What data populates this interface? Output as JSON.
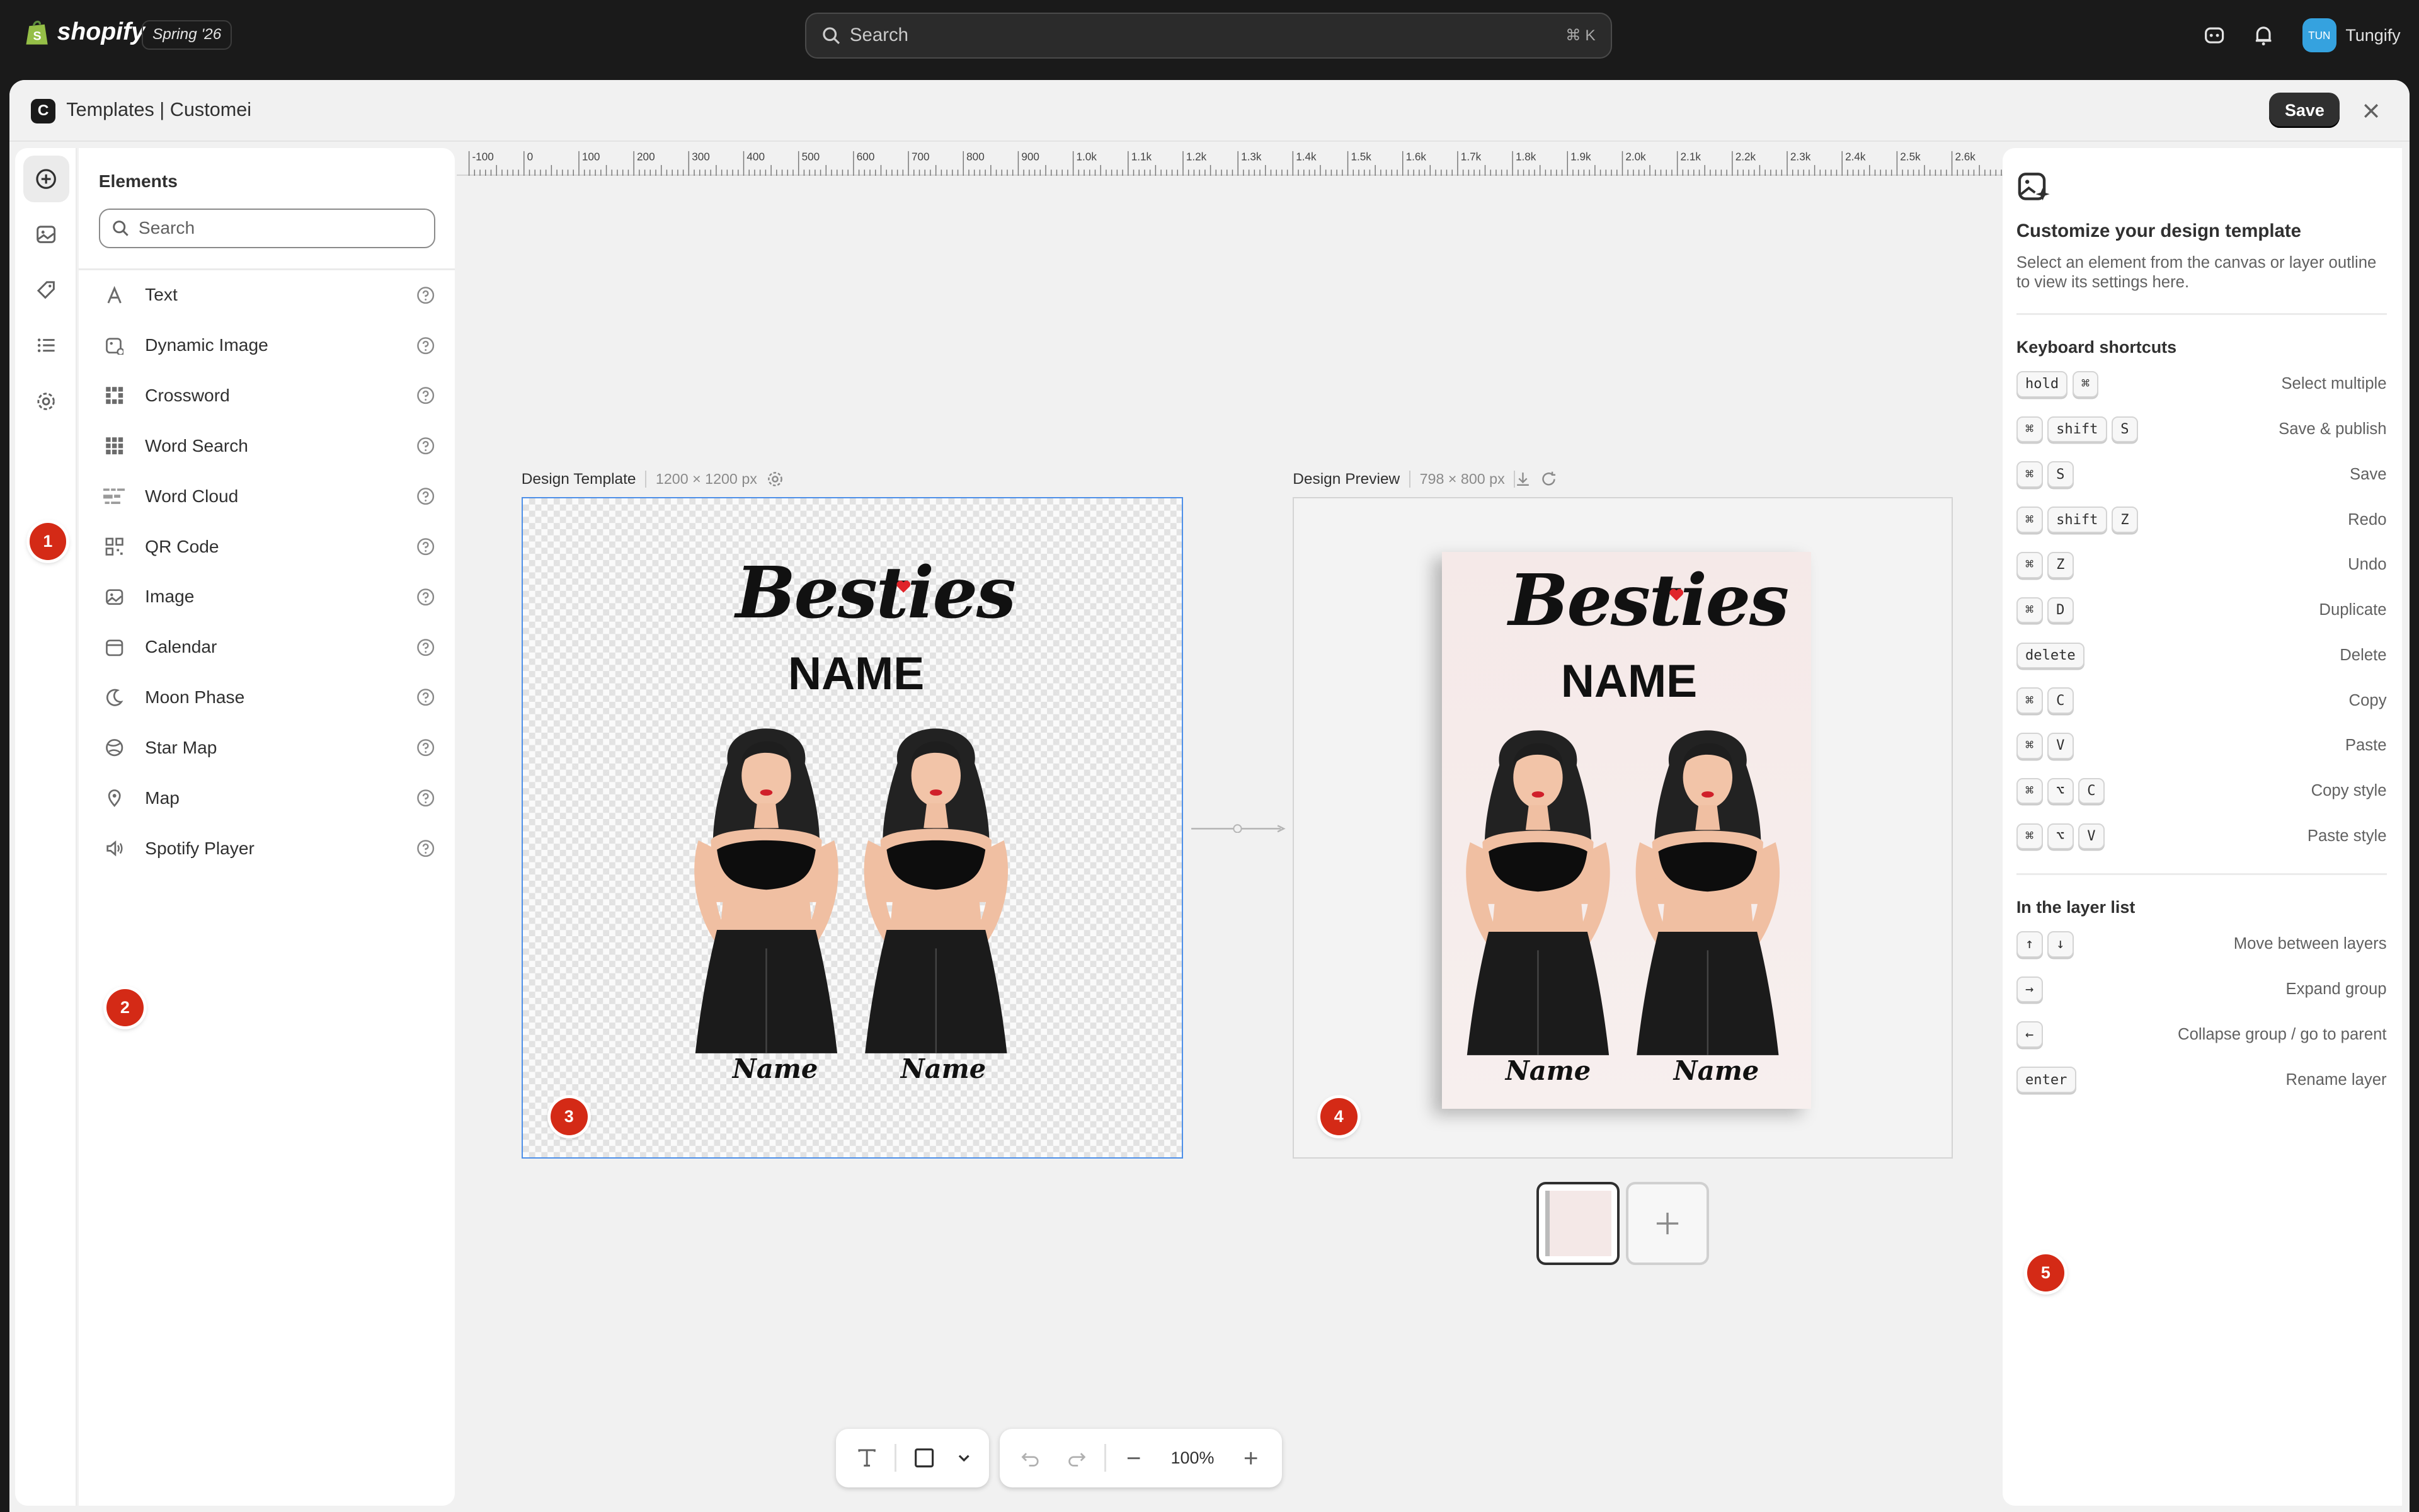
{
  "topbar": {
    "brand": "shopify",
    "edition": "Spring '26",
    "search_placeholder": "Search",
    "search_shortcut": "⌘  K",
    "user_initials": "TUN",
    "user_name": "Tungify"
  },
  "modal": {
    "app_icon": "C",
    "title": "Templates | Customei",
    "save_label": "Save"
  },
  "elements_panel": {
    "title": "Elements",
    "search_placeholder": "Search",
    "items": [
      {
        "label": "Text",
        "icon": "text-icon"
      },
      {
        "label": "Dynamic Image",
        "icon": "dynamic-image-icon"
      },
      {
        "label": "Crossword",
        "icon": "crossword-icon"
      },
      {
        "label": "Word Search",
        "icon": "word-search-icon"
      },
      {
        "label": "Word Cloud",
        "icon": "word-cloud-icon"
      },
      {
        "label": "QR Code",
        "icon": "qr-code-icon"
      },
      {
        "label": "Image",
        "icon": "image-icon"
      },
      {
        "label": "Calendar",
        "icon": "calendar-icon"
      },
      {
        "label": "Moon Phase",
        "icon": "moon-icon"
      },
      {
        "label": "Star Map",
        "icon": "star-map-icon"
      },
      {
        "label": "Map",
        "icon": "map-pin-icon"
      },
      {
        "label": "Spotify Player",
        "icon": "speaker-icon"
      }
    ]
  },
  "ruler": {
    "labels": [
      "-100",
      "0",
      "100",
      "200",
      "300",
      "400",
      "500",
      "600",
      "700",
      "800",
      "900",
      "1.0k",
      "1.1k",
      "1.2k",
      "1.3k",
      "1.4k",
      "1.5k",
      "1.6k",
      "1.7k",
      "1.8k",
      "1.9k",
      "2.0k",
      "2.1k",
      "2.2k",
      "2.3k",
      "2.4k",
      "2.5k",
      "2.6k"
    ]
  },
  "design_template": {
    "label": "Design Template",
    "size": "1200 × 1200 px"
  },
  "design_preview": {
    "label": "Design Preview",
    "size": "798 × 800 px"
  },
  "artwork": {
    "headline": "Besties",
    "subheadline": "NAME",
    "name_left": "Name",
    "name_right": "Name"
  },
  "bottom_toolbar": {
    "zoom": "100%"
  },
  "right_panel": {
    "title": "Customize your design template",
    "description": "Select an element from the canvas or layer outline to view its settings here.",
    "shortcuts_title": "Keyboard shortcuts",
    "shortcuts": [
      {
        "keys": [
          "hold",
          "⌘"
        ],
        "label": "Select multiple"
      },
      {
        "keys": [
          "⌘",
          "shift",
          "S"
        ],
        "label": "Save & publish"
      },
      {
        "keys": [
          "⌘",
          "S"
        ],
        "label": "Save"
      },
      {
        "keys": [
          "⌘",
          "shift",
          "Z"
        ],
        "label": "Redo"
      },
      {
        "keys": [
          "⌘",
          "Z"
        ],
        "label": "Undo"
      },
      {
        "keys": [
          "⌘",
          "D"
        ],
        "label": "Duplicate"
      },
      {
        "keys": [
          "delete"
        ],
        "label": "Delete"
      },
      {
        "keys": [
          "⌘",
          "C"
        ],
        "label": "Copy"
      },
      {
        "keys": [
          "⌘",
          "V"
        ],
        "label": "Paste"
      },
      {
        "keys": [
          "⌘",
          "⌥",
          "C"
        ],
        "label": "Copy style"
      },
      {
        "keys": [
          "⌘",
          "⌥",
          "V"
        ],
        "label": "Paste style"
      }
    ],
    "layer_title": "In the layer list",
    "layer_shortcuts": [
      {
        "keys": [
          "↑",
          "↓"
        ],
        "label": "Move between layers"
      },
      {
        "keys": [
          "→"
        ],
        "label": "Expand group"
      },
      {
        "keys": [
          "←"
        ],
        "label": "Collapse group / go to parent"
      },
      {
        "keys": [
          "enter"
        ],
        "label": "Rename layer"
      }
    ]
  },
  "markers": [
    "1",
    "2",
    "3",
    "4",
    "5"
  ],
  "colors": {
    "accent_blue": "#4d8fe8",
    "marker_red": "#d42a16",
    "topbar_bg": "#1a1a1a"
  }
}
